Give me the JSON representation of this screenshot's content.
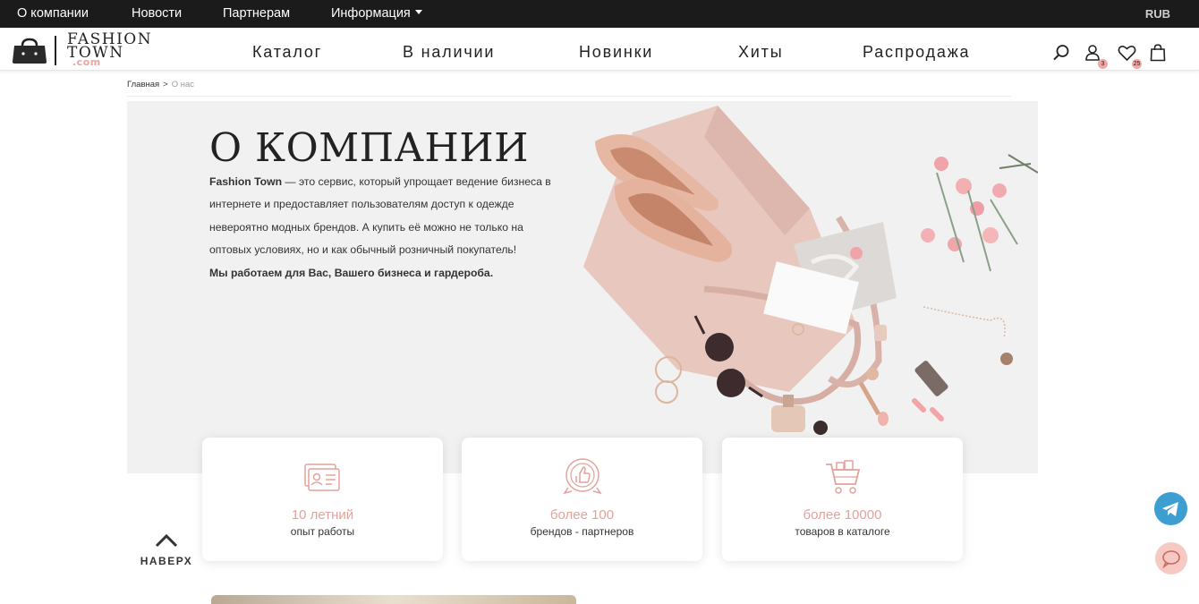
{
  "topbar": {
    "links": [
      "О компании",
      "Новости",
      "Партнерам",
      "Информация"
    ],
    "currency": "RUB"
  },
  "logo": {
    "line1": "FASHION",
    "line2": "TOWN",
    "line3": ".com"
  },
  "main_nav": [
    "Каталог",
    "В наличии",
    "Новинки",
    "Хиты",
    "Распродажа"
  ],
  "header_icons": {
    "profile_badge": "3",
    "favorites_badge": "25"
  },
  "breadcrumb": {
    "home": "Главная",
    "separator": ">",
    "current": "О нас"
  },
  "hero": {
    "title": "О КОМПАНИИ",
    "brand": "Fashion Town",
    "text": " — это сервис, который упрощает ведение бизнеса в интернете и предоставляет пользователям доступ к одежде невероятно модных брендов. А купить её можно не только на оптовых условиях, но и как обычный розничный покупатель!",
    "tagline": "Мы работаем для Вас, Вашего бизнеса и гардероба."
  },
  "stats": [
    {
      "value": "10 летний",
      "label": "опыт работы",
      "icon": "id-card-icon"
    },
    {
      "value": "более 100",
      "label": "брендов - партнеров",
      "icon": "like-badge-icon"
    },
    {
      "value": "более 10000",
      "label": "товаров в каталоге",
      "icon": "shopping-cart-icon"
    }
  ],
  "to_top": {
    "label": "НАВЕРХ"
  },
  "colors": {
    "accent": "#e3a29b",
    "topbar": "#1b1b1b",
    "telegram": "#3c9ed1",
    "chat": "#f7c9c3"
  }
}
